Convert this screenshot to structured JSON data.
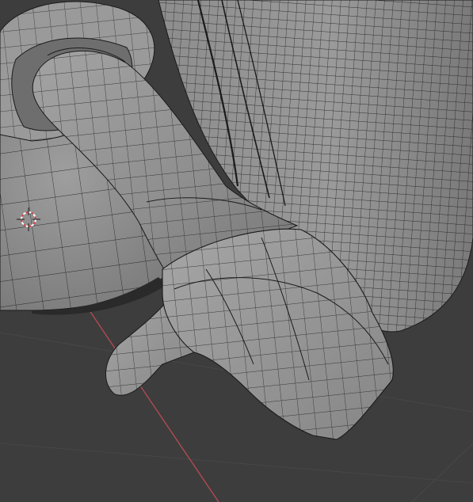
{
  "viewport": {
    "background_color": "#3d3d3d",
    "mesh_surface_color": "#8f8f8f",
    "mesh_highlight_color": "#a8a8a8",
    "wire_color": "#1a1a1a",
    "x_axis_color": "#b04a52",
    "grid_color": "#474747"
  },
  "cursor": {
    "icon": "3d-cursor-icon",
    "primary_color": "#d64545",
    "secondary_color": "#ffffff"
  }
}
